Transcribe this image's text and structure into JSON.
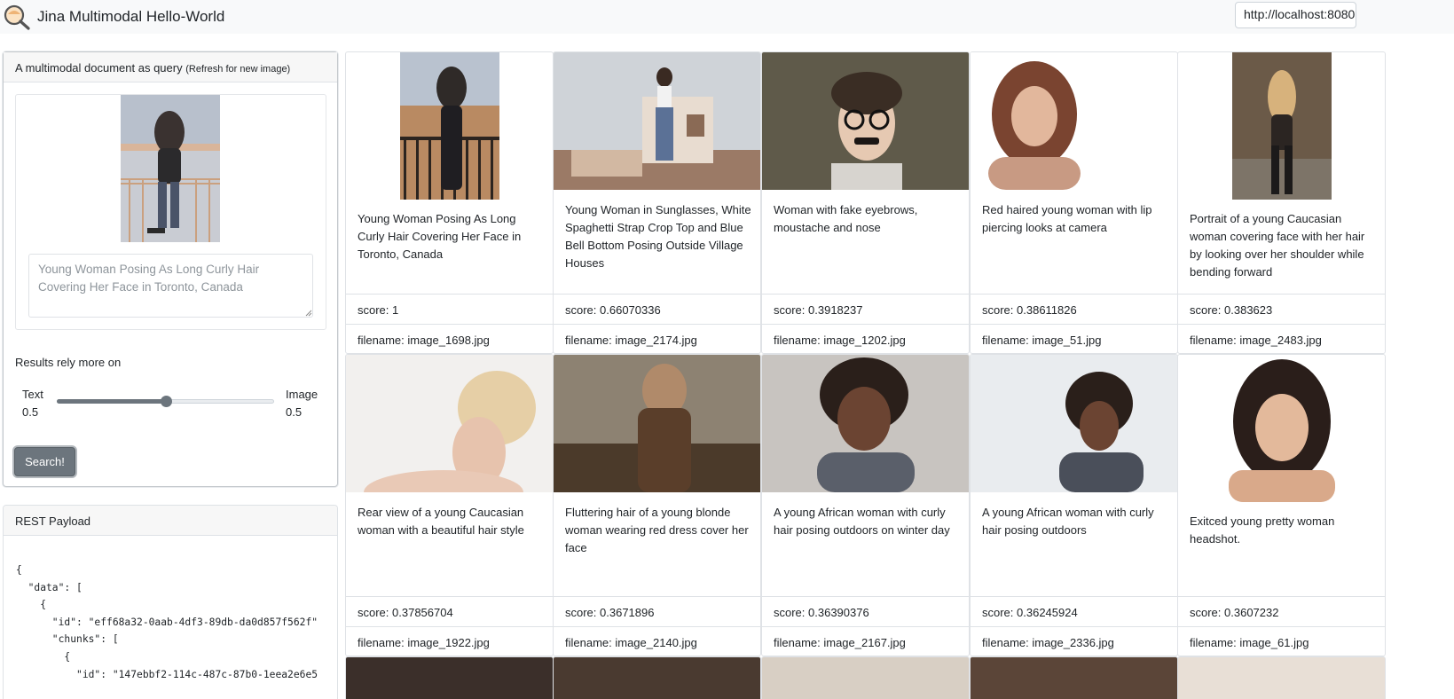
{
  "app": {
    "title": "Jina Multimodal Hello-World",
    "logo_icon": "jina-search-logo-icon",
    "endpoint": "http://localhost:8080"
  },
  "query": {
    "header": "A multimodal document as query",
    "header_hint": "(Refresh for new image)",
    "text": "Young Woman Posing As Long Curly Hair Covering Her Face in Toronto, Canada",
    "rely_label": "Results rely more on",
    "text_label": "Text",
    "text_weight": "0.5",
    "image_label": "Image",
    "image_weight": "0.5",
    "slider_value": 0.5,
    "search_label": "Search!"
  },
  "rest": {
    "header": "REST Payload",
    "lines": [
      "{",
      "  \"data\": [",
      "    {",
      "      \"id\": \"eff68a32-0aab-4df3-89db-da0d857f562f\"",
      "      \"chunks\": [",
      "        {",
      "          \"id\": \"147ebbf2-114c-487c-87b0-1eea2e6e5"
    ]
  },
  "results": [
    {
      "caption": "Young Woman Posing As Long Curly Hair Covering Her Face in Toronto, Canada",
      "score": "score: 1",
      "filename": "filename: image_1698.jpg",
      "image": "woman-balcony-photo"
    },
    {
      "caption": "Young Woman in Sunglasses, White Spaghetti Strap Crop Top and Blue Bell Bottom Posing Outside Village Houses",
      "score": "score: 0.66070336",
      "filename": "filename: image_2174.jpg",
      "image": "woman-village-photo"
    },
    {
      "caption": "Woman with fake eyebrows, moustache and nose",
      "score": "score: 0.3918237",
      "filename": "filename: image_1202.jpg",
      "image": "woman-disguise-photo"
    },
    {
      "caption": "Red haired young woman with lip piercing looks at camera",
      "score": "score: 0.38611826",
      "filename": "filename: image_51.jpg",
      "image": "red-hair-woman-photo"
    },
    {
      "caption": "Portrait of a young Caucasian woman covering face with her hair by looking over her shoulder while bending forward",
      "score": "score: 0.383623",
      "filename": "filename: image_2483.jpg",
      "image": "woman-bending-photo"
    },
    {
      "caption": "Rear view of a young Caucasian woman with a beautiful hair style",
      "score": "score: 0.37856704",
      "filename": "filename: image_1922.jpg",
      "image": "woman-rear-view-photo"
    },
    {
      "caption": "Fluttering hair of a young blonde woman wearing red dress cover her face",
      "score": "score: 0.3671896",
      "filename": "filename: image_2140.jpg",
      "image": "woman-fluttering-hair-photo"
    },
    {
      "caption": "A young African woman with curly hair posing outdoors on winter day",
      "score": "score: 0.36390376",
      "filename": "filename: image_2167.jpg",
      "image": "african-woman-winter-photo"
    },
    {
      "caption": "A young African woman with curly hair posing outdoors",
      "score": "score: 0.36245924",
      "filename": "filename: image_2336.jpg",
      "image": "african-woman-outdoors-photo"
    },
    {
      "caption": "Exitced young pretty woman headshot.",
      "score": "score: 0.3607232",
      "filename": "filename: image_61.jpg",
      "image": "excited-woman-headshot-photo"
    }
  ]
}
